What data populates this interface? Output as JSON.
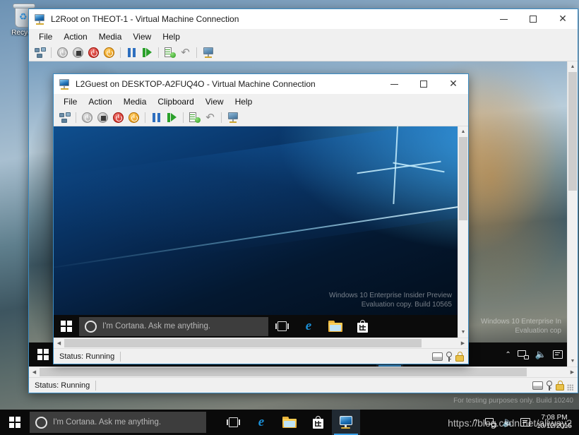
{
  "host_desktop": {
    "recycle_bin_label": "Recycle",
    "watermark_line1": "For testing purposes only. Build 10240",
    "icons": {
      "recycle_bin": "recycle-bin-icon"
    }
  },
  "host_taskbar": {
    "start_label": "Start",
    "cortana_placeholder": "I'm Cortana. Ask me anything.",
    "items": [
      {
        "name": "task-view",
        "label": "Task View"
      },
      {
        "name": "edge",
        "label": "Microsoft Edge",
        "glyph": "e"
      },
      {
        "name": "file-explorer",
        "label": "File Explorer"
      },
      {
        "name": "store",
        "label": "Store"
      },
      {
        "name": "vmconnect",
        "label": "Virtual Machine Connection",
        "active": true
      }
    ],
    "tray": {
      "chevron": "⌃",
      "network_label": "Network",
      "volume_glyph": "🔊",
      "action_center_label": "Action Center"
    },
    "clock_time": "7:08 PM",
    "clock_date": "10/12/2015",
    "watermark": "https://blog.csdn.net/allway2"
  },
  "outer_window": {
    "title": "L2Root on THEOT-1 - Virtual Machine Connection",
    "app_icon": "vmconnect-icon",
    "menus": [
      "File",
      "Action",
      "Media",
      "View",
      "Help"
    ],
    "toolbar": [
      {
        "name": "ctrl-alt-delete",
        "title": "Ctrl+Alt+Delete"
      },
      {
        "name": "shut-down",
        "title": "Shut Down"
      },
      {
        "name": "turn-off",
        "title": "Turn Off"
      },
      {
        "name": "reset",
        "title": "Reset"
      },
      {
        "name": "start",
        "title": "Start"
      },
      {
        "name": "pause",
        "title": "Pause"
      },
      {
        "name": "resume",
        "title": "Resume"
      },
      {
        "name": "checkpoint",
        "title": "Checkpoint"
      },
      {
        "name": "revert",
        "title": "Revert"
      },
      {
        "name": "enhanced-session",
        "title": "Enhanced Session"
      }
    ],
    "status_text": "Status: Running",
    "controls": {
      "minimize": "—",
      "maximize": "☐",
      "close": "✕"
    }
  },
  "inner_window": {
    "title": "L2Guest on DESKTOP-A2FUQ4O - Virtual Machine Connection",
    "app_icon": "vmconnect-icon",
    "menus": [
      "File",
      "Action",
      "Media",
      "Clipboard",
      "View",
      "Help"
    ],
    "toolbar": [
      {
        "name": "ctrl-alt-delete",
        "title": "Ctrl+Alt+Delete"
      },
      {
        "name": "shut-down",
        "title": "Shut Down"
      },
      {
        "name": "turn-off",
        "title": "Turn Off"
      },
      {
        "name": "reset",
        "title": "Reset"
      },
      {
        "name": "start",
        "title": "Start"
      },
      {
        "name": "pause",
        "title": "Pause"
      },
      {
        "name": "resume",
        "title": "Resume"
      },
      {
        "name": "checkpoint",
        "title": "Checkpoint"
      },
      {
        "name": "revert",
        "title": "Revert"
      },
      {
        "name": "enhanced-session",
        "title": "Enhanced Session"
      }
    ],
    "status_text": "Status: Running",
    "controls": {
      "minimize": "—",
      "maximize": "☐",
      "close": "✕"
    }
  },
  "guest_desktop": {
    "watermark_line1": "Windows 10 Enterprise Insider Preview",
    "watermark_line2": "Evaluation copy. Build 10565",
    "taskbar": {
      "cortana_placeholder": "I'm Cortana. Ask me anything.",
      "items": [
        {
          "name": "task-view",
          "label": "Task View"
        },
        {
          "name": "edge",
          "label": "Microsoft Edge",
          "glyph": "e"
        },
        {
          "name": "file-explorer",
          "label": "File Explorer"
        },
        {
          "name": "store",
          "label": "Store"
        }
      ]
    }
  },
  "middle_desktop": {
    "watermark_line1": "Windows 10 Enterprise In",
    "watermark_line2": "Evaluation cop"
  },
  "colors": {
    "accent": "#3aa0e8",
    "window_border": "#3b8cc4",
    "chrome_bg": "#f0f0f0",
    "taskbar_bg": "#0a0a0a",
    "cortana_bg": "#3d3d3d"
  }
}
